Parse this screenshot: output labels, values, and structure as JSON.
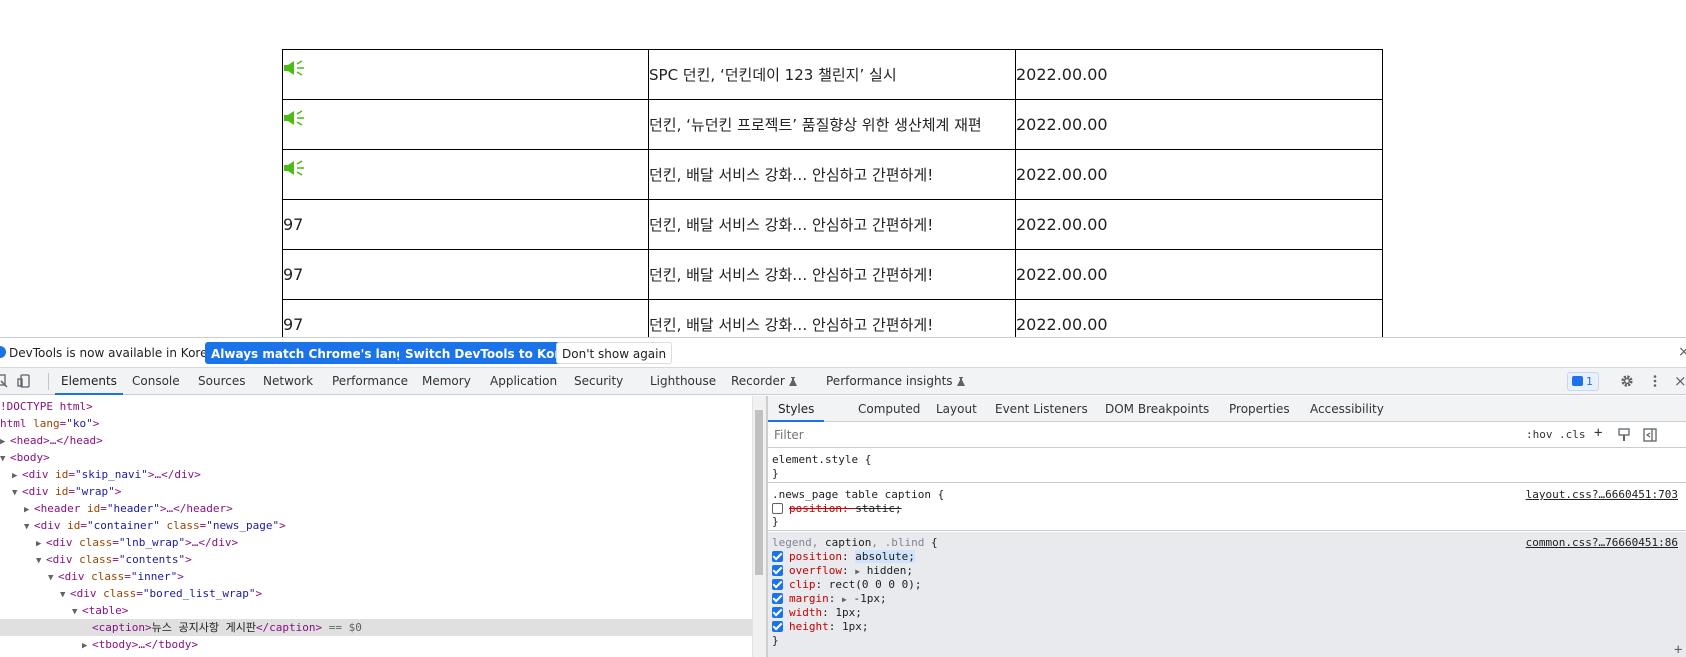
{
  "news_table": {
    "rows": [
      {
        "type": "notice",
        "title": "SPC 던킨, ‘던킨데이 123 챌린지’ 실시",
        "date": "2022.00.00"
      },
      {
        "type": "notice",
        "title": "던킨, ‘뉴던킨 프로젝트’ 품질향상 위한 생산체계 재편",
        "date": "2022.00.00"
      },
      {
        "type": "notice",
        "title": "던킨, 배달 서비스 강화… 안심하고 간편하게!",
        "date": "2022.00.00"
      },
      {
        "type": "number",
        "num": "97",
        "title": "던킨, 배달 서비스 강화… 안심하고 간편하게!",
        "date": "2022.00.00"
      },
      {
        "type": "number",
        "num": "97",
        "title": "던킨, 배달 서비스 강화… 안심하고 간편하게!",
        "date": "2022.00.00"
      },
      {
        "type": "number",
        "num": "97",
        "title": "던킨, 배달 서비스 강화… 안심하고 간편하게!",
        "date": "2022.00.00"
      }
    ],
    "notice_icon": "megaphone-icon",
    "notice_icon_color": "#4cbb17"
  },
  "infobar": {
    "message": "DevTools is now available in Korean!",
    "btn_match": "Always match Chrome's language",
    "btn_switch": "Switch DevTools to Korean",
    "btn_dismiss": "Don't show again",
    "close": "×"
  },
  "toolbar": {
    "tabs": [
      "Elements",
      "Console",
      "Sources",
      "Network",
      "Performance",
      "Memory",
      "Application",
      "Security",
      "Lighthouse",
      "Recorder",
      "Performance insights"
    ],
    "issues_count": "1",
    "close": "×"
  },
  "dom_tree": {
    "doctype": "!DOCTYPE html>",
    "html_open": "html",
    "lang_attr": "lang",
    "lang_val": "\"ko\"",
    "head": "<head>…</head>",
    "body": "<body>",
    "div": "div",
    "id": "id",
    "class": "class",
    "skip_navi": "\"skip_navi\"",
    "wrap": "\"wrap\"",
    "header_tag": "header",
    "header_id": "\"header\"",
    "header_close": ">…</header>",
    "container_id": "\"container\"",
    "news_page": "\"news_page\"",
    "lnb_wrap": "\"lnb_wrap\"",
    "contents": "\"contents\"",
    "inner": "\"inner\"",
    "bored_list_wrap": "\"bored_list_wrap\"",
    "table": "<table>",
    "caption_open": "<caption>",
    "caption_text": "뉴스 공지사항 게시판",
    "caption_close": "</caption>",
    "eq0": " == $0",
    "tbody": "<tbody>…</tbody>",
    "collapsed_div": ">…</div>"
  },
  "styles": {
    "subtabs": [
      "Styles",
      "Computed",
      "Layout",
      "Event Listeners",
      "DOM Breakpoints",
      "Properties",
      "Accessibility"
    ],
    "filter_placeholder": "Filter",
    "hov": ":hov",
    "cls": ".cls",
    "plus": "+",
    "rule1_selector": "element.style {",
    "rule1_close": "}",
    "rule2_selector": ".news_page table caption {",
    "rule2_source": "layout.css?…6660451:703",
    "rule2_prop": "position",
    "rule2_val": "static;",
    "rule2_close": "}",
    "rule3_sel_dim1": "legend",
    "rule3_sel_main": "caption",
    "rule3_sel_dim2": ".blind",
    "rule3_source": "common.css?…76660451:86",
    "rule3_decls": [
      {
        "prop": "position",
        "val": "absolute;"
      },
      {
        "prop": "overflow",
        "val": "hidden;"
      },
      {
        "prop": "clip",
        "val": "rect(0 0 0 0);"
      },
      {
        "prop": "margin",
        "val": "-1px;"
      },
      {
        "prop": "width",
        "val": "1px;"
      },
      {
        "prop": "height",
        "val": "1px;"
      }
    ],
    "rule3_close": "}"
  }
}
